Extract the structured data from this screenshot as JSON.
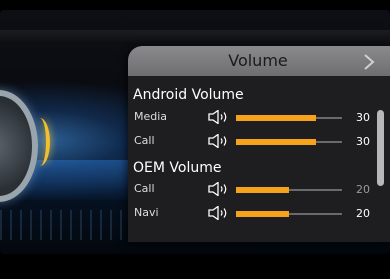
{
  "panel": {
    "title": "Volume"
  },
  "sections": [
    {
      "heading": "Android Volume",
      "rows": [
        {
          "label": "Media",
          "value": "30",
          "level": 0.75
        },
        {
          "label": "Call",
          "value": "30",
          "level": 0.75
        }
      ]
    },
    {
      "heading": "OEM Volume",
      "rows": [
        {
          "label": "Call",
          "value": "20",
          "level": 0.5
        },
        {
          "label": "Navi",
          "value": "20",
          "level": 0.5
        }
      ]
    }
  ],
  "icons": {
    "close": "chevron-right-icon",
    "speaker": "speaker-icon"
  },
  "colors": {
    "accent": "#f6a21b",
    "header": "#7a7a7c",
    "panel_bg": "#1e1e20"
  }
}
